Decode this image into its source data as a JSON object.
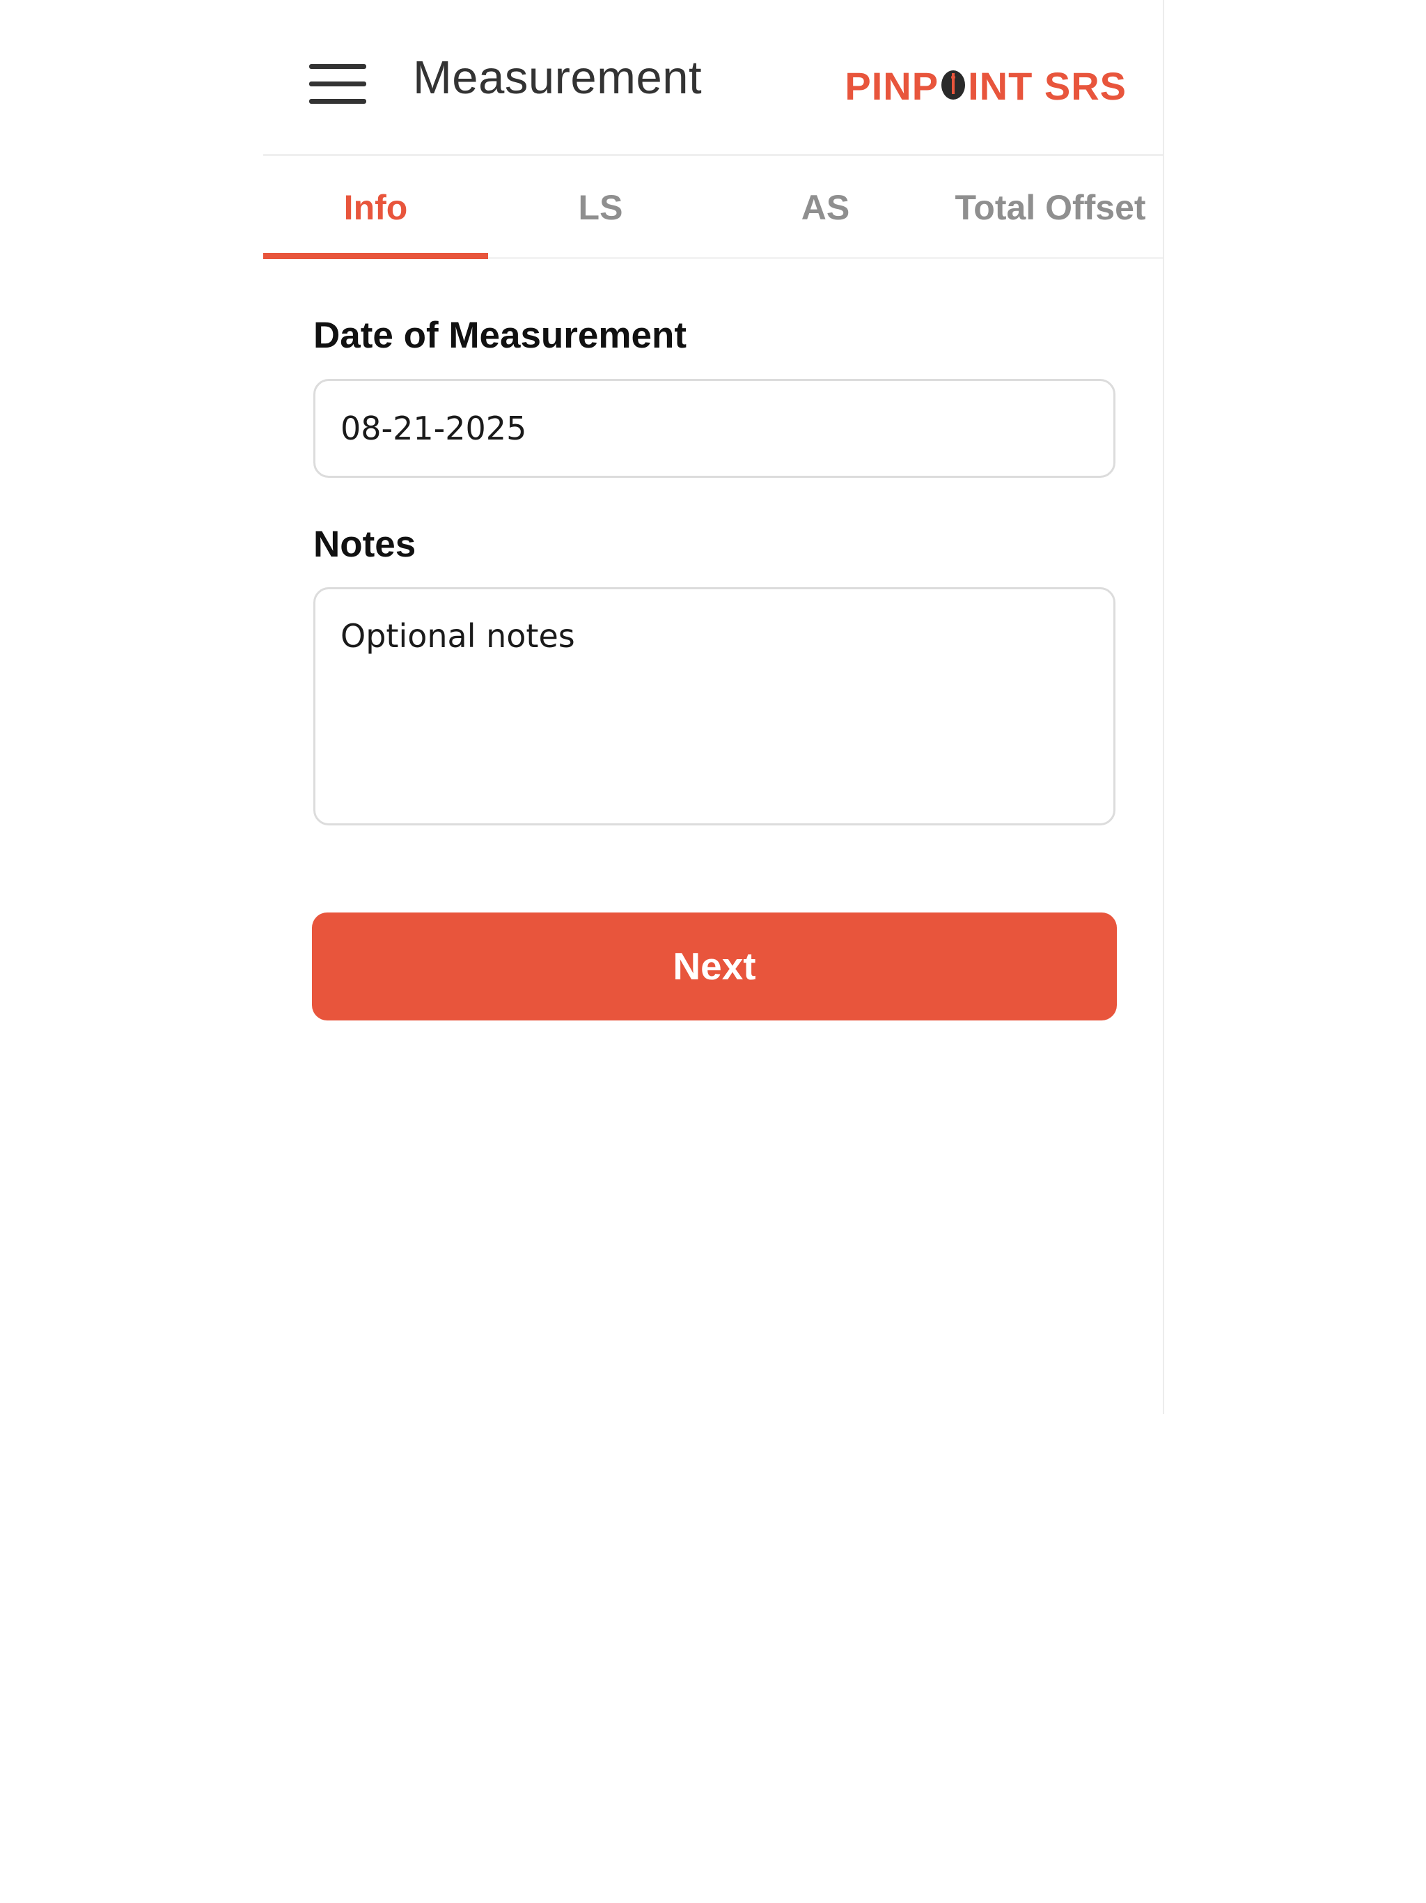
{
  "header": {
    "title": "Measurement",
    "logo_left": "PINP",
    "logo_right": "INT SRS",
    "menu_icon": "hamburger-menu-icon"
  },
  "tabs": [
    {
      "label": "Info",
      "active": true
    },
    {
      "label": "LS",
      "active": false
    },
    {
      "label": "AS",
      "active": false
    },
    {
      "label": "Total Offset",
      "active": false
    }
  ],
  "form": {
    "date_label": "Date of Measurement",
    "date_value": "08-21-2025",
    "notes_label": "Notes",
    "notes_placeholder": "Optional notes",
    "next_label": "Next"
  },
  "colors": {
    "accent": "#e8553c",
    "tab_inactive": "#8f8f8f",
    "text_dark": "#333333"
  }
}
